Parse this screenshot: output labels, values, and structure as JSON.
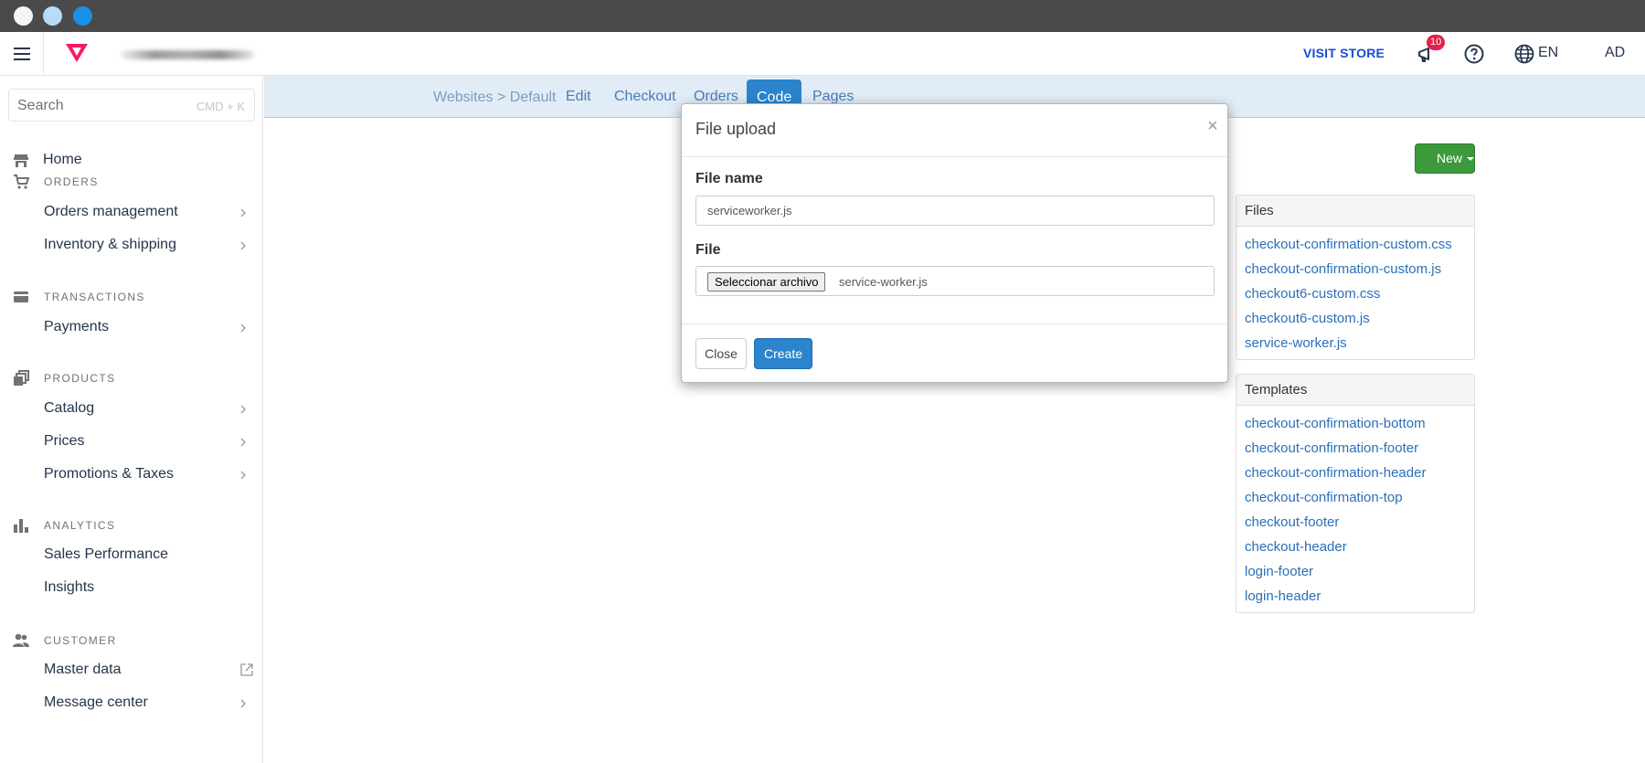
{
  "window": {
    "controls": [
      "close",
      "minimize",
      "maximize"
    ]
  },
  "topbar": {
    "menu_icon": "hamburger-icon",
    "logo": "vtex-logo",
    "visit_store": "VISIT STORE",
    "notifications_count": "10",
    "language": "EN",
    "avatar": "AD"
  },
  "sidebar": {
    "search_placeholder": "Search",
    "search_shortcut": "CMD + K",
    "home": "Home",
    "sections": {
      "orders": "ORDERS",
      "transactions": "TRANSACTIONS",
      "products": "PRODUCTS",
      "analytics": "ANALYTICS",
      "customer": "CUSTOMER"
    },
    "items": {
      "orders_management": "Orders management",
      "inventory_shipping": "Inventory & shipping",
      "payments": "Payments",
      "catalog": "Catalog",
      "prices": "Prices",
      "promotions_taxes": "Promotions & Taxes",
      "sales_performance": "Sales Performance",
      "insights": "Insights",
      "master_data": "Master data",
      "message_center": "Message center"
    }
  },
  "subnav": {
    "breadcrumb_root": "Websites",
    "breadcrumb_sep": ">",
    "breadcrumb_current": "Default",
    "tabs": {
      "edit": "Edit",
      "checkout": "Checkout",
      "orders": "Orders",
      "code": "Code",
      "pages": "Pages"
    },
    "active_tab": "Code"
  },
  "toolbar": {
    "new_label": "New"
  },
  "files_panel": {
    "title": "Files",
    "items": [
      "checkout-confirmation-custom.css",
      "checkout-confirmation-custom.js",
      "checkout6-custom.css",
      "checkout6-custom.js",
      "service-worker.js"
    ]
  },
  "templates_panel": {
    "title": "Templates",
    "items": [
      "checkout-confirmation-bottom",
      "checkout-confirmation-footer",
      "checkout-confirmation-header",
      "checkout-confirmation-top",
      "checkout-footer",
      "checkout-header",
      "login-footer",
      "login-header"
    ]
  },
  "modal": {
    "title": "File upload",
    "close_glyph": "×",
    "file_name_label": "File name",
    "file_name_value": "serviceworker.js",
    "file_label": "File",
    "file_button": "Seleccionar archivo",
    "file_chosen": "service-worker.js",
    "close_button": "Close",
    "create_button": "Create"
  },
  "colors": {
    "accent_blue": "#2b84cc",
    "new_green": "#3c9a3c",
    "badge_red": "#e3214a",
    "vtex_pink": "#f71963"
  }
}
